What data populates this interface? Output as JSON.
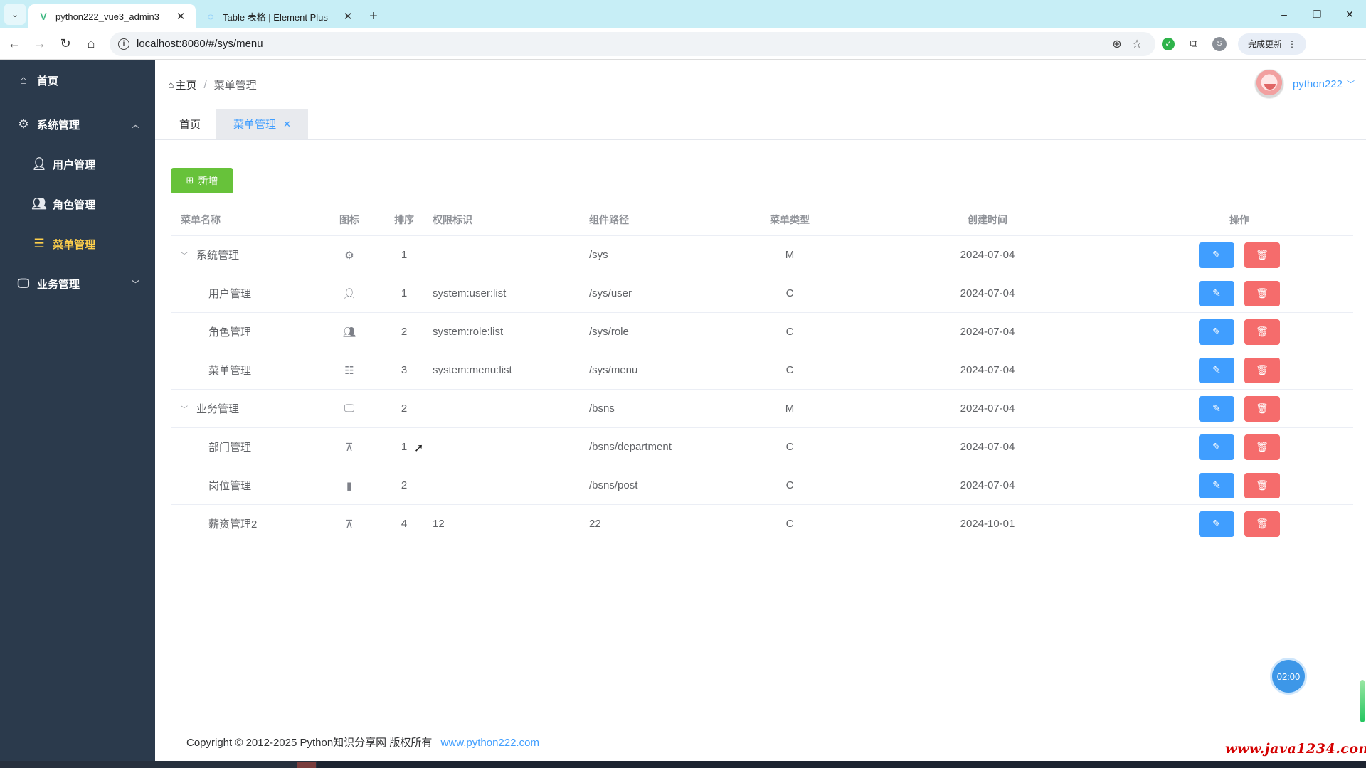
{
  "browser": {
    "tabs": [
      {
        "title": "python222_vue3_admin3",
        "active": true
      },
      {
        "title": "Table 表格 | Element Plus",
        "active": false
      }
    ],
    "url": "localhost:8080/#/sys/menu",
    "update_label": "完成更新",
    "profile_initial": "S"
  },
  "sidebar": {
    "items": [
      {
        "label": "首页",
        "icon": "home-icon"
      },
      {
        "label": "系统管理",
        "icon": "gear-icon",
        "expanded": true,
        "children": [
          {
            "label": "用户管理",
            "icon": "user-icon"
          },
          {
            "label": "角色管理",
            "icon": "users-icon"
          },
          {
            "label": "菜单管理",
            "icon": "list-icon",
            "active": true
          }
        ]
      },
      {
        "label": "业务管理",
        "icon": "monitor-icon",
        "expanded": false
      }
    ],
    "active_color": "#ffd04b",
    "bg_color": "#2b3a4c"
  },
  "header": {
    "breadcrumb": {
      "home": "主页",
      "current": "菜单管理"
    },
    "username": "python222"
  },
  "page_tabs": [
    {
      "label": "首页",
      "active": false
    },
    {
      "label": "菜单管理",
      "active": true,
      "closable": true
    }
  ],
  "toolbar": {
    "add_label": "新增"
  },
  "table": {
    "columns": [
      "菜单名称",
      "图标",
      "排序",
      "权限标识",
      "组件路径",
      "菜单类型",
      "创建时间",
      "操作"
    ],
    "rows": [
      {
        "name": "系统管理",
        "icon": "gear-icon",
        "order": "1",
        "perms": "",
        "path": "/sys",
        "type": "M",
        "created": "2024-07-04",
        "level": 0,
        "expanded": true
      },
      {
        "name": "用户管理",
        "icon": "user-icon",
        "order": "1",
        "perms": "system:user:list",
        "path": "/sys/user",
        "type": "C",
        "created": "2024-07-04",
        "level": 1
      },
      {
        "name": "角色管理",
        "icon": "users-icon",
        "order": "2",
        "perms": "system:role:list",
        "path": "/sys/role",
        "type": "C",
        "created": "2024-07-04",
        "level": 1
      },
      {
        "name": "菜单管理",
        "icon": "list-icon",
        "order": "3",
        "perms": "system:menu:list",
        "path": "/sys/menu",
        "type": "C",
        "created": "2024-07-04",
        "level": 1
      },
      {
        "name": "业务管理",
        "icon": "monitor-icon",
        "order": "2",
        "perms": "",
        "path": "/bsns",
        "type": "M",
        "created": "2024-07-04",
        "level": 0,
        "expanded": true
      },
      {
        "name": "部门管理",
        "icon": "sitemap-icon",
        "order": "1",
        "perms": "",
        "path": "/bsns/department",
        "type": "C",
        "created": "2024-07-04",
        "level": 1
      },
      {
        "name": "岗位管理",
        "icon": "post-icon",
        "order": "2",
        "perms": "",
        "path": "/bsns/post",
        "type": "C",
        "created": "2024-07-04",
        "level": 1
      },
      {
        "name": "薪资管理2",
        "icon": "sitemap-icon",
        "order": "4",
        "perms": "12",
        "path": "22",
        "type": "C",
        "created": "2024-10-01",
        "level": 1
      }
    ]
  },
  "timer": "02:00",
  "footer": {
    "text": "Copyright © 2012-2025 Python知识分享网 版权所有",
    "link": "www.python222.com"
  },
  "watermark": "www.java1234.com",
  "colors": {
    "primary": "#409eff",
    "success": "#67c23a",
    "danger": "#f56c6c"
  }
}
